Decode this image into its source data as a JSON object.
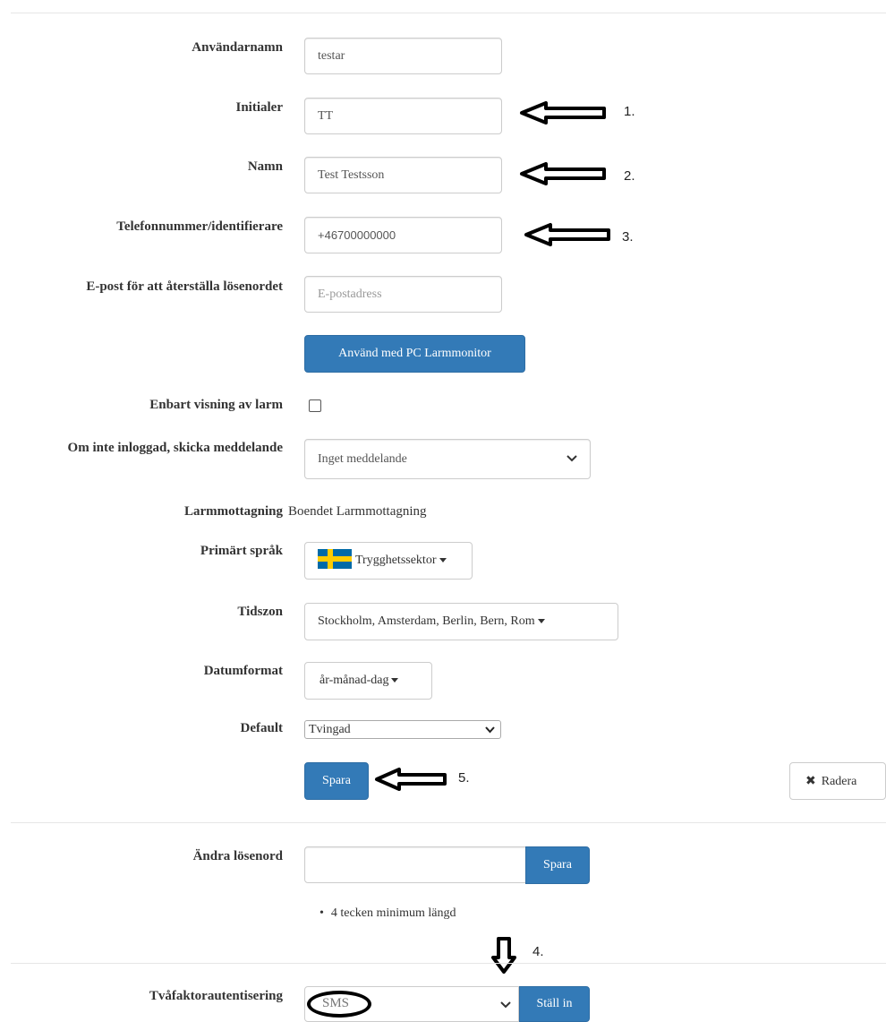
{
  "form": {
    "username": {
      "label": "Användarnamn",
      "value": "testar"
    },
    "initials": {
      "label": "Initialer",
      "value": "TT"
    },
    "name": {
      "label": "Namn",
      "value": "Test Testsson"
    },
    "phone": {
      "label": "Telefonnummer/identifierare",
      "value": "+46700000000"
    },
    "email": {
      "label": "E-post för att återställa lösenordet",
      "placeholder": "E-postadress"
    },
    "pc_button": "Använd med PC Larmmonitor",
    "view_only": {
      "label": "Enbart visning av larm",
      "checked": false
    },
    "not_logged_in": {
      "label": "Om inte inloggad, skicka meddelande",
      "value": "Inget meddelande"
    },
    "alarm_reception": {
      "label": "Larmmottagning",
      "value": "Boendet Larmmottagning"
    },
    "primary_language": {
      "label": "Primärt språk",
      "value": "Trygghetssektor"
    },
    "timezone": {
      "label": "Tidszon",
      "value": "Stockholm, Amsterdam, Berlin, Bern, Rom"
    },
    "date_format": {
      "label": "Datumformat",
      "value": "år-månad-dag"
    },
    "default": {
      "label": "Default",
      "value": "Tvingad"
    },
    "save_button": "Spara",
    "delete_button": "Radera"
  },
  "password": {
    "label": "Ändra lösenord",
    "value": "",
    "save_button": "Spara",
    "hint": "4 tecken minimum längd"
  },
  "two_factor": {
    "label": "Tvåfaktorautentisering",
    "value": "SMS",
    "set_button": "Ställ in"
  },
  "annotations": {
    "a1": "1.",
    "a2": "2.",
    "a3": "3.",
    "a4": "4.",
    "a5": "5."
  },
  "colors": {
    "primary": "#337ab7",
    "flag_blue": "#006aa7",
    "flag_yellow": "#fecc00"
  }
}
